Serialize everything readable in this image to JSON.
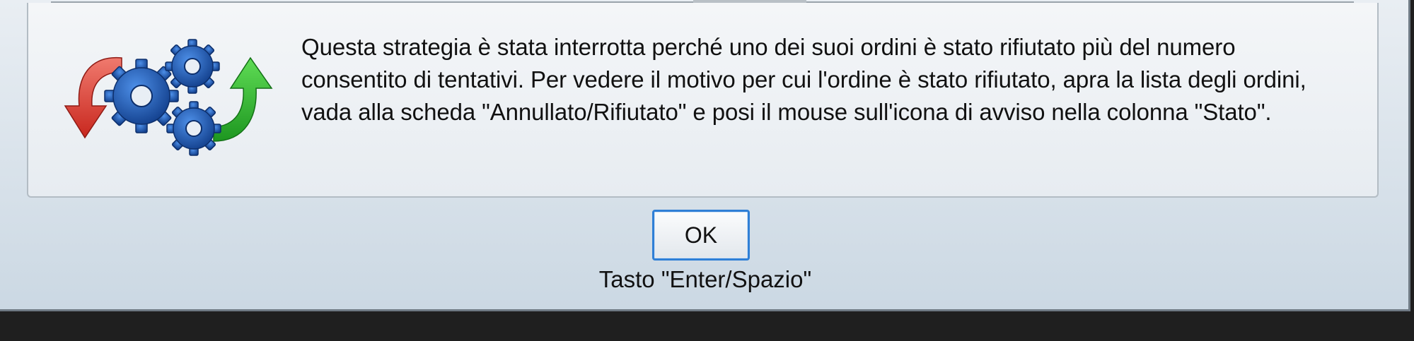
{
  "dialog": {
    "message": "Questa strategia è stata interrotta perché uno dei suoi ordini è stato rifiutato più del numero consentito di tentativi. Per vedere il motivo per cui l'ordine è stato rifiutato, apra la lista degli ordini, vada alla scheda \"Annullato/Rifiutato\" e posi il mouse sull'icona di avviso nella colonna \"Stato\".",
    "icon": "strategy-gears-restart-icon",
    "ok_label": "OK",
    "key_hint": "Tasto \"Enter/Spazio\""
  },
  "colors": {
    "gear": "#1b57b3",
    "arrow_left": "#e4473c",
    "arrow_right": "#2db52d",
    "button_border": "#2f7fd6",
    "background": "#1f1f1f"
  }
}
